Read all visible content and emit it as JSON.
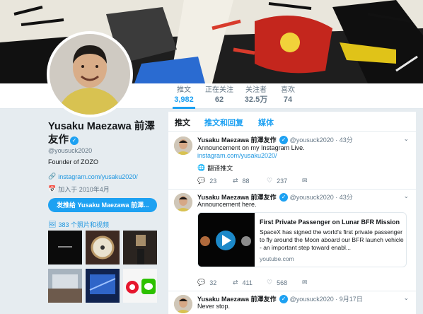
{
  "profile": {
    "name": "Yusaku Maezawa 前澤友作",
    "handle": "@yousuck2020",
    "bio": "Founder of ZOZO",
    "website": "instagram.com/yusaku2020/",
    "joined": "加入于 2010年4月",
    "tweet_to_button": "发推给 Yusaku Maezawa 前澤...",
    "media_label": "383 个照片和视频"
  },
  "nav": {
    "stats": [
      {
        "label": "推文",
        "value": "3,982",
        "active": true
      },
      {
        "label": "正在关注",
        "value": "62",
        "active": false
      },
      {
        "label": "关注者",
        "value": "32.5万",
        "active": false
      },
      {
        "label": "喜欢",
        "value": "74",
        "active": false
      }
    ]
  },
  "timeline": {
    "tabs": [
      "推文",
      "推文和回复",
      "媒体"
    ],
    "tweets": [
      {
        "name": "Yusaku Maezawa 前澤友作",
        "handle": "@yousuck2020",
        "time": "43分",
        "text": "Announcement on my Instagram Live.",
        "link": "instagram.com/yusaku2020/",
        "translate": "翻译推文",
        "replies": "23",
        "retweets": "88",
        "likes": "237"
      },
      {
        "name": "Yusaku Maezawa 前澤友作",
        "handle": "@yousuck2020",
        "time": "43分",
        "text": "Announcement here.",
        "card": {
          "title": "First Private Passenger on Lunar BFR Mission",
          "description": "SpaceX has signed the world's first private passenger to fly around the Moon aboard our BFR launch vehicle - an important step toward enabl...",
          "domain": "youtube.com"
        },
        "replies": "32",
        "retweets": "411",
        "likes": "568"
      },
      {
        "name": "Yusaku Maezawa 前澤友作",
        "handle": "@yousuck2020",
        "time": "9月17日",
        "text": "Never stop."
      }
    ]
  },
  "colors": {
    "accent": "#1da1f2",
    "link": "#1b95e0",
    "muted": "#657786"
  }
}
